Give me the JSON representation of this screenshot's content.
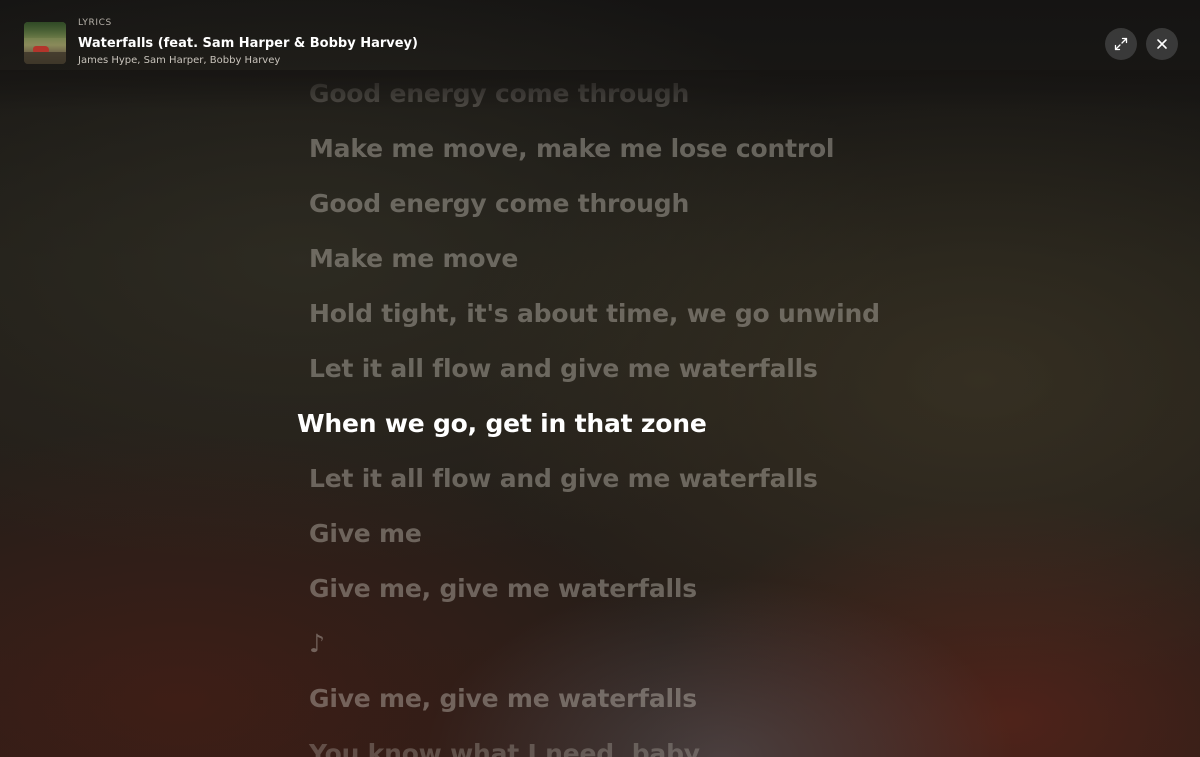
{
  "header": {
    "eyebrow": "LYRICS",
    "title": "Waterfalls (feat. Sam Harper & Bobby Harvey)",
    "artists": "James Hype, Sam Harper, Bobby Harvey",
    "expand_icon": "expand-icon",
    "close_icon": "close-icon"
  },
  "lyrics": {
    "lines": [
      "Good energy come through",
      "Make me move, make me lose control",
      "Good energy come through",
      "Make me move",
      "Hold tight, it's about time, we go unwind",
      "Let it all flow and give me waterfalls",
      "When we go, get in that zone",
      "Let it all flow and give me waterfalls",
      "Give me",
      "Give me, give me waterfalls",
      "♪",
      "Give me, give me waterfalls",
      "You know what I need, baby"
    ],
    "active_index": 6
  },
  "colors": {
    "active_line": "#ffffff",
    "inactive_line": "rgba(200,195,185,0.42)"
  }
}
